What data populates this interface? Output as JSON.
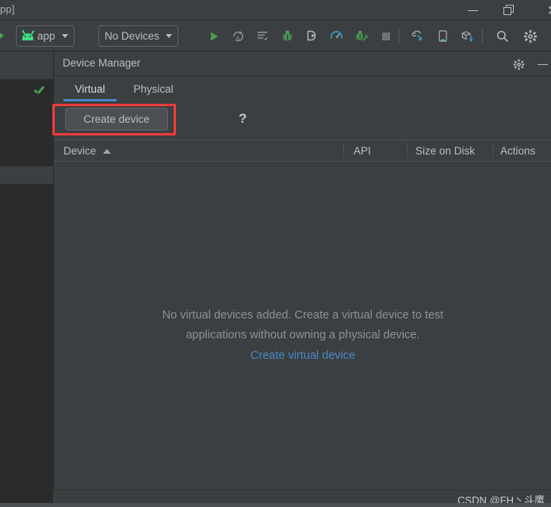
{
  "window": {
    "title_fragment": "pp]",
    "controls": {
      "minimize": "minimize-window",
      "restore": "restore-window",
      "close": "close-window"
    }
  },
  "toolbar": {
    "run_config": {
      "label": "app",
      "icon": "android-robot-icon"
    },
    "device_target": {
      "label": "No Devices"
    },
    "buttons": [
      {
        "name": "run-button",
        "icon": "play-icon",
        "color": "#499c54"
      },
      {
        "name": "apply-changes-button",
        "icon": "apply-code-changes-icon",
        "color": "#8d9194"
      },
      {
        "name": "apply-changes-restart-button",
        "icon": "apply-changes-restart-icon",
        "color": "#8d9194"
      },
      {
        "name": "debug-button",
        "icon": "bug-icon",
        "color": "#499c54"
      },
      {
        "name": "attach-debugger-button",
        "icon": "attach-debugger-icon",
        "color": "#b0b4b7"
      },
      {
        "name": "profiler-button",
        "icon": "profiler-gauge-icon",
        "color": "#3592c4"
      },
      {
        "name": "run-with-coverage-button",
        "icon": "coverage-bug-icon",
        "color": "#499c54"
      },
      {
        "name": "stop-button",
        "icon": "stop-square-icon",
        "color": "#6e7376"
      },
      {
        "name": "device-file-explorer-button",
        "icon": "device-manager-icon",
        "color": "#3592c4"
      },
      {
        "name": "layout-inspector-button",
        "icon": "phone-android-icon",
        "color": "#3ddc84"
      },
      {
        "name": "sdk-download-button",
        "icon": "box-download-icon",
        "color": "#3592c4"
      },
      {
        "name": "search-everywhere-button",
        "icon": "search-icon",
        "color": "#b0b4b7"
      },
      {
        "name": "settings-button",
        "icon": "gear-icon",
        "color": "#b0b4b7"
      }
    ]
  },
  "device_manager": {
    "title": "Device Manager",
    "header_icons": [
      {
        "name": "device-manager-settings-icon",
        "icon": "gear-icon"
      },
      {
        "name": "device-manager-minimize-icon",
        "icon": "minimize-icon"
      }
    ],
    "tabs": [
      {
        "label": "Virtual",
        "active": true
      },
      {
        "label": "Physical",
        "active": false
      }
    ],
    "actions": {
      "create_device_label": "Create device",
      "help_label": "?"
    },
    "table": {
      "columns": [
        {
          "label": "Device",
          "sorted": true,
          "sort_direction": "ascending"
        },
        {
          "label": "API",
          "sorted": false
        },
        {
          "label": "Size on Disk",
          "sorted": false
        },
        {
          "label": "Actions",
          "sorted": false
        }
      ],
      "rows": []
    },
    "empty_state": {
      "line1": "No virtual devices added. Create a virtual device to test",
      "line2": "applications without owning a physical device.",
      "link": "Create virtual device"
    }
  },
  "editor": {
    "inspection_status_icon": "green-checkmark-icon"
  },
  "status_bar": {
    "watermark": "CSDN @FH丶斗鹰"
  },
  "colors": {
    "background": "#3c3f41",
    "editor_background": "#2b2b2b",
    "accent_blue": "#4a88c7",
    "android_green": "#3ddc84",
    "run_green": "#499c54",
    "highlight_red": "#f23b3b",
    "text_primary": "#bbbbbb",
    "text_muted": "#8d9194"
  }
}
